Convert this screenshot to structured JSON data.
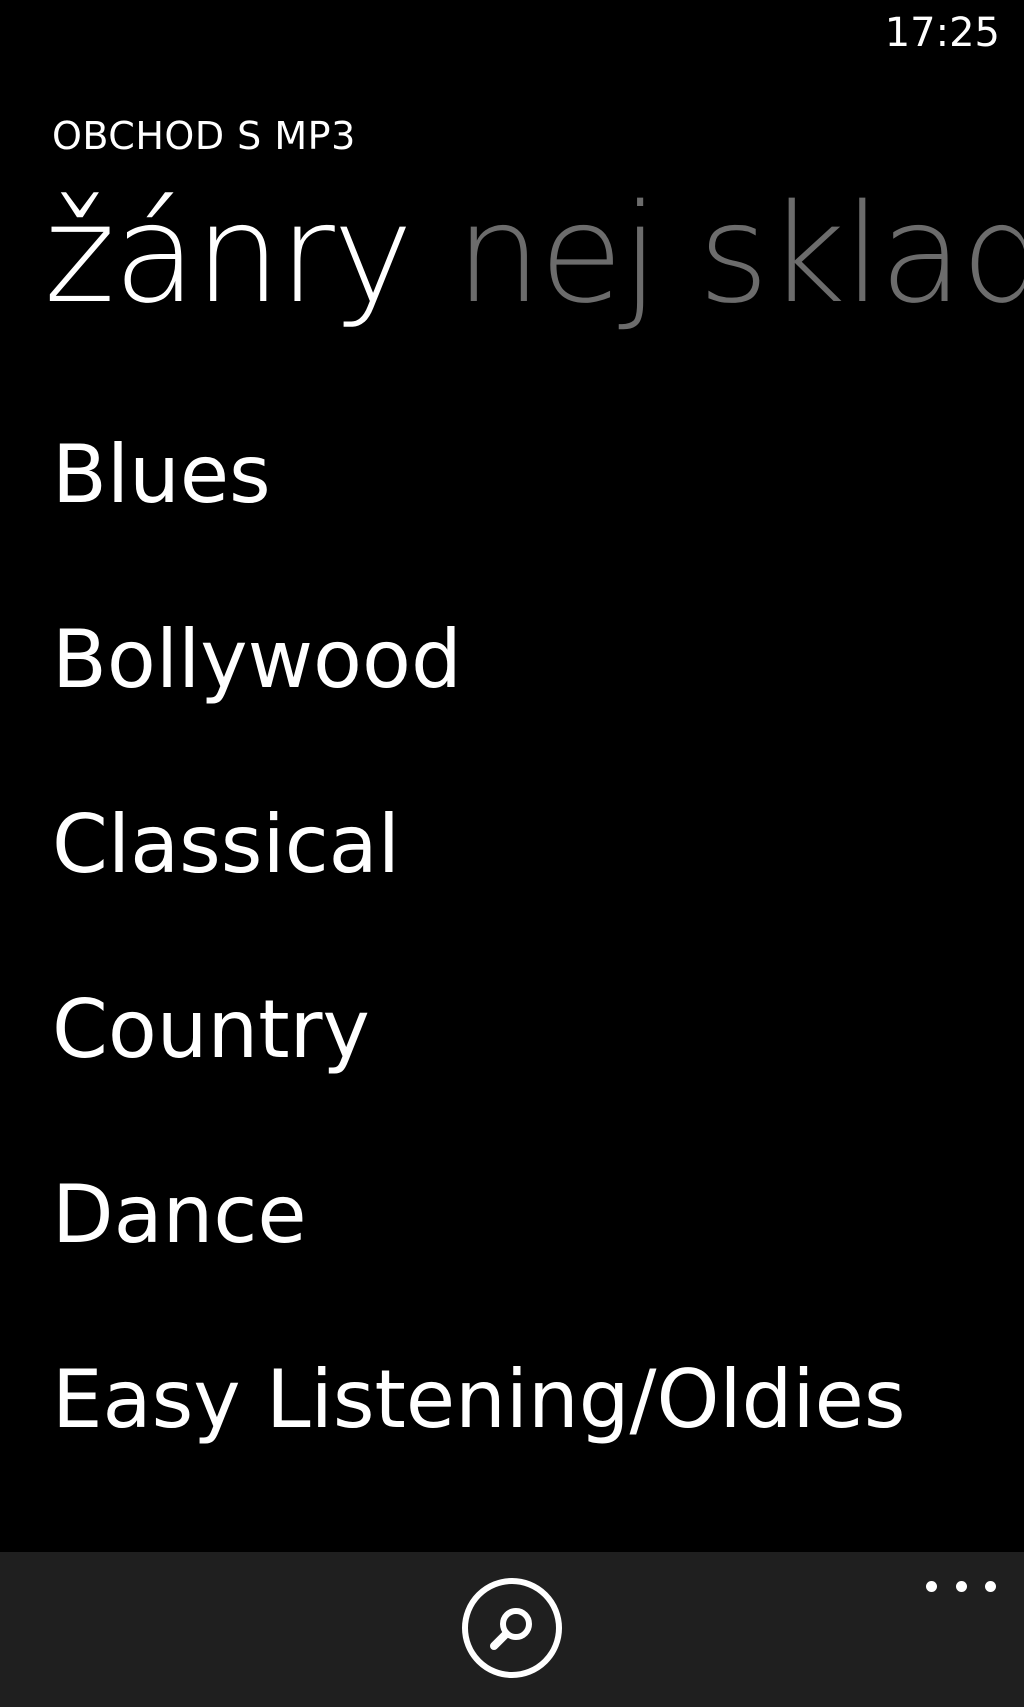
{
  "status_bar": {
    "time": "17:25"
  },
  "app": {
    "title": "OBCHOD S MP3"
  },
  "pivot": {
    "items": [
      {
        "label": "žánry",
        "active": true
      },
      {
        "label": "nej sklad",
        "active": false
      }
    ]
  },
  "genres": [
    "Blues",
    "Bollywood",
    "Classical",
    "Country",
    "Dance",
    "Easy Listening/Oldies"
  ],
  "app_bar": {
    "search_icon": "search-icon",
    "more_icon": "more-icon"
  },
  "colors": {
    "background": "#000000",
    "text": "#ffffff",
    "inactive_pivot": "#6c6c6c",
    "app_bar": "#1f1f1f"
  }
}
